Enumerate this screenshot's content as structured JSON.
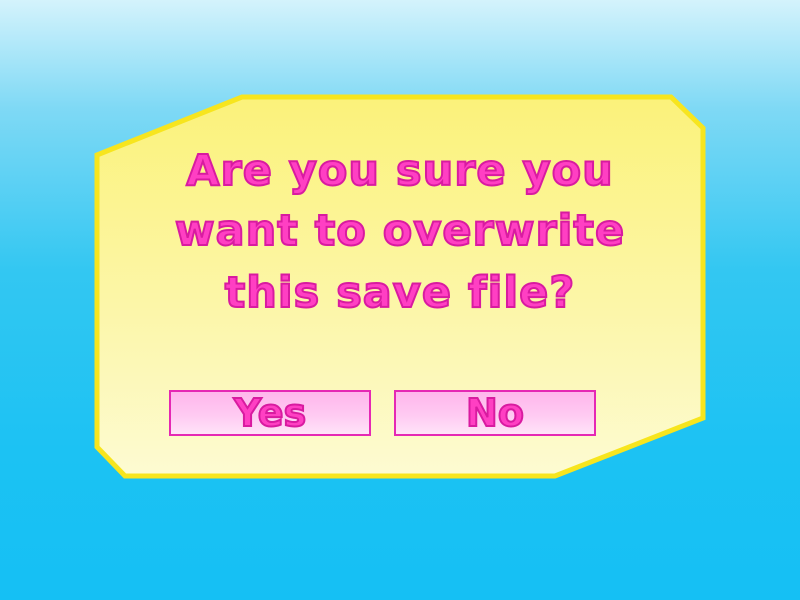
{
  "dialog": {
    "message_lines": [
      "Are you sure you",
      "want to overwrite",
      "this save file?"
    ],
    "yes_label": "Yes",
    "no_label": "No"
  },
  "colors": {
    "panel_fill_top": "#fbf27a",
    "panel_fill_bottom": "#fdfbd2",
    "panel_border": "#f7e51e",
    "text_pink": "#ff3fc3",
    "text_outline": "#d81ba0",
    "button_fill": "#ffc0ef",
    "background_top": "#d4f3fc",
    "background_bottom": "#15c0f4"
  }
}
